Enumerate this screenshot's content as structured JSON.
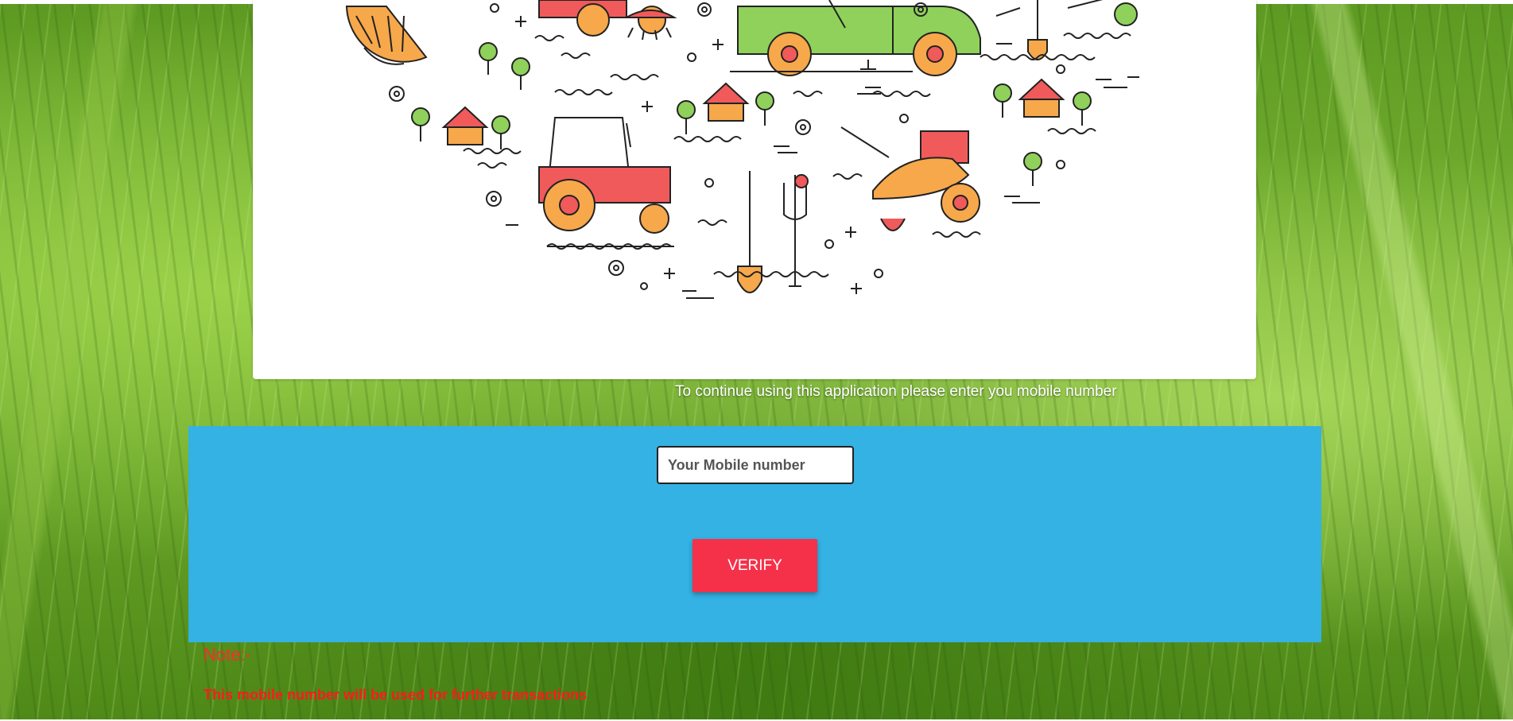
{
  "hero": {
    "illustration": "farm-equipment-illustration"
  },
  "instruction_text": "To continue using this application please enter you mobile number",
  "form": {
    "mobile_placeholder": "Your Mobile number",
    "mobile_value": "",
    "verify_label": "VERIFY"
  },
  "note": {
    "label": "Note:-",
    "text": "This mobile number will be used for further transactions"
  },
  "colors": {
    "panel": "#33b2e3",
    "button": "#f5314a",
    "note": "#ff1a1a"
  }
}
